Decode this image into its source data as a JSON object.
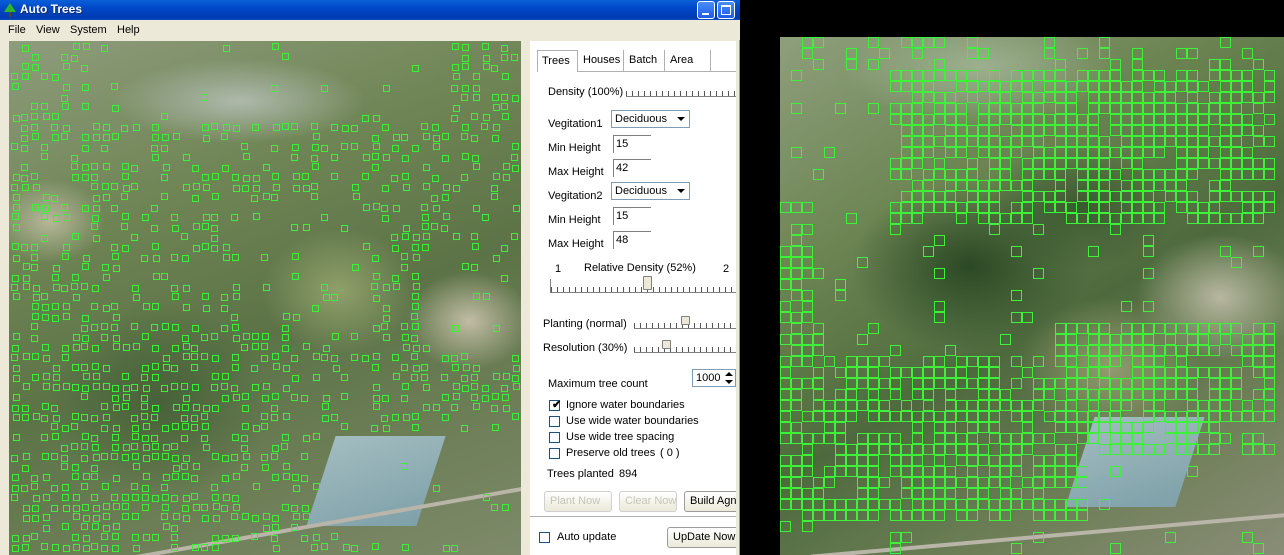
{
  "window": {
    "title": "Auto Trees"
  },
  "menu": [
    "File",
    "View",
    "System",
    "Help"
  ],
  "tabs": [
    "Trees",
    "Houses",
    "Batch",
    "Area"
  ],
  "trees_panel": {
    "density_label": "Density (100%)",
    "density_value": 1.0,
    "vegetation1_label": "Vegitation1",
    "vegetation1_value": "Deciduous",
    "min_height_label": "Min Height",
    "max_height_label": "Max Height",
    "min_height1": "15",
    "max_height1": "42",
    "vegetation2_label": "Vegitation2",
    "vegetation2_value": "Deciduous",
    "min_height2": "15",
    "max_height2": "48",
    "relative_density_left": "1",
    "relative_density_label": "Relative Density (52%)",
    "relative_density_right": "2",
    "relative_density_value": 0.52,
    "planting_label": "Planting (normal)",
    "planting_value": 0.5,
    "resolution_label": "Resolution (30%)",
    "resolution_value": 0.3,
    "max_tree_count_label": "Maximum tree count",
    "max_tree_count": "1000",
    "checkboxes": [
      {
        "label": "Ignore water boundaries",
        "checked": true
      },
      {
        "label": "Use wide water boundaries",
        "checked": false
      },
      {
        "label": "Use wide tree spacing",
        "checked": false
      },
      {
        "label": "Preserve old trees",
        "checked": false
      }
    ],
    "preserve_count": "( 0 )",
    "trees_planted_label": "Trees planted",
    "trees_planted": "894",
    "buttons": {
      "plant": "Plant Now",
      "clear": "Clear Now",
      "build": "Build Agn"
    },
    "auto_update_label": "Auto update",
    "auto_update_checked": false,
    "update_now": "UpDate Now"
  },
  "colors": {
    "tree_marker": "#39f236",
    "title_bar": "#0048c8",
    "window_bg": "#ece9d8"
  },
  "icons": {
    "app": "tree-icon",
    "minimize": "minimize-icon",
    "maximize": "maximize-icon"
  }
}
